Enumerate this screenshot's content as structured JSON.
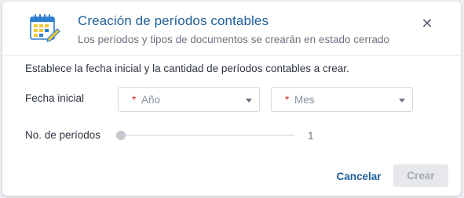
{
  "dialog": {
    "title": "Creación de períodos contables",
    "subtitle": "Los períodos y tipos de documentos se crearán en estado cerrado",
    "icon": "calendar-icon",
    "close_icon": "close-icon",
    "close_label": "✕"
  },
  "form": {
    "instruction": "Establece la fecha inicial y la cantidad de períodos contables a crear.",
    "fecha_label": "Fecha inicial",
    "anio": {
      "required_mark": "*",
      "placeholder": "Año"
    },
    "mes": {
      "required_mark": "*",
      "placeholder": "Mes"
    },
    "periodos_label": "No. de períodos",
    "periodos_value": "1"
  },
  "actions": {
    "cancel_label": "Cancelar",
    "create_label": "Crear"
  },
  "colors": {
    "accent": "#1f5f99",
    "required": "#d8262c",
    "icon_blue": "#2f7fd1",
    "icon_yellow": "#f3c73a"
  }
}
